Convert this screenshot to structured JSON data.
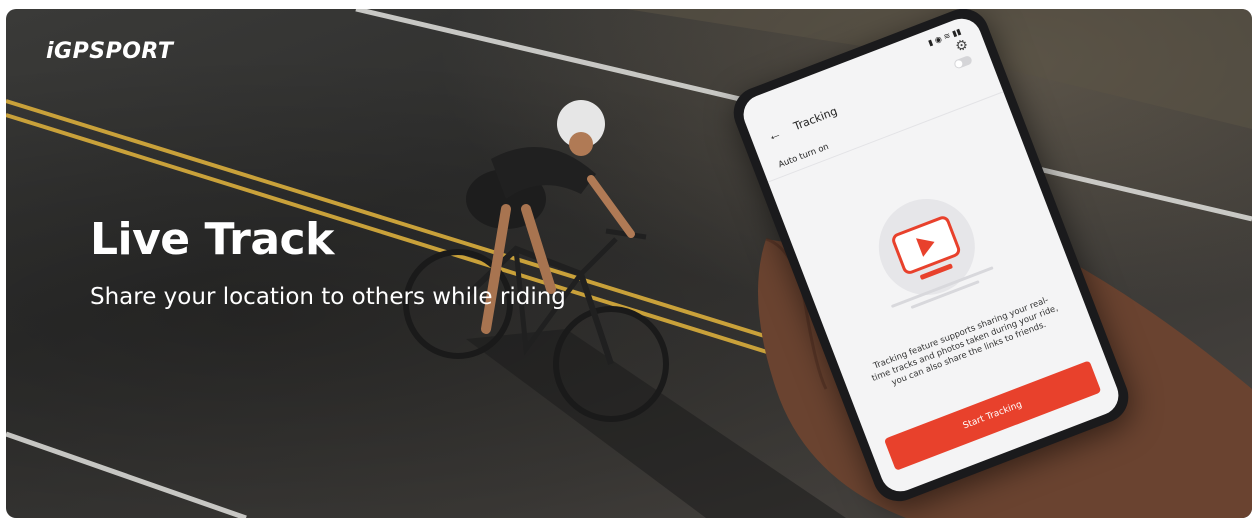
{
  "brand": {
    "logo_text": "iGPSPORT"
  },
  "hero": {
    "title": "Live Track",
    "subtitle": "Share your location to others while riding"
  },
  "phone": {
    "screen_title": "Tracking",
    "auto_turn_on_label": "Auto turn on",
    "auto_turn_on_enabled": false,
    "description": "Tracking feature supports sharing your real-time tracks and photos taken during your ride, you can also share the links to friends.",
    "start_button_label": "Start Tracking"
  },
  "colors": {
    "accent": "#e8412c",
    "text_light": "#ffffff"
  }
}
